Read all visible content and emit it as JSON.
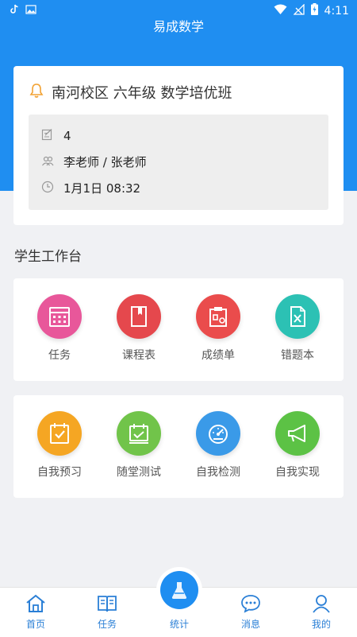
{
  "status_bar": {
    "time": "4:11"
  },
  "app_title": "易成数学",
  "class_card": {
    "title": "南河校区 六年级 数学培优班",
    "count": "4",
    "teachers": "李老师 / 张老师",
    "schedule": "1月1日 08:32"
  },
  "workbench": {
    "title": "学生工作台",
    "row1": [
      {
        "label": "任务",
        "icon": "calendar-grid-icon",
        "color": "#e8579a"
      },
      {
        "label": "课程表",
        "icon": "book-icon",
        "color": "#e5484d"
      },
      {
        "label": "成绩单",
        "icon": "clipboard-icon",
        "color": "#ea4c4c"
      },
      {
        "label": "错题本",
        "icon": "excel-file-icon",
        "color": "#2cc1b4"
      }
    ],
    "row2": [
      {
        "label": "自我预习",
        "icon": "calendar-check-icon",
        "color": "#f5a623"
      },
      {
        "label": "随堂测试",
        "icon": "calendar-edit-icon",
        "color": "#71c44a"
      },
      {
        "label": "自我检测",
        "icon": "speedometer-icon",
        "color": "#3a9ae8"
      },
      {
        "label": "自我实现",
        "icon": "megaphone-icon",
        "color": "#5cc245"
      }
    ]
  },
  "bottom_nav": [
    {
      "label": "首页",
      "icon": "home-icon"
    },
    {
      "label": "任务",
      "icon": "book-open-icon"
    },
    {
      "label": "统计",
      "icon": "flask-icon"
    },
    {
      "label": "消息",
      "icon": "chat-icon"
    },
    {
      "label": "我的",
      "icon": "user-icon"
    }
  ],
  "colors": {
    "primary": "#1f8ef1",
    "background": "#f0f1f4"
  }
}
